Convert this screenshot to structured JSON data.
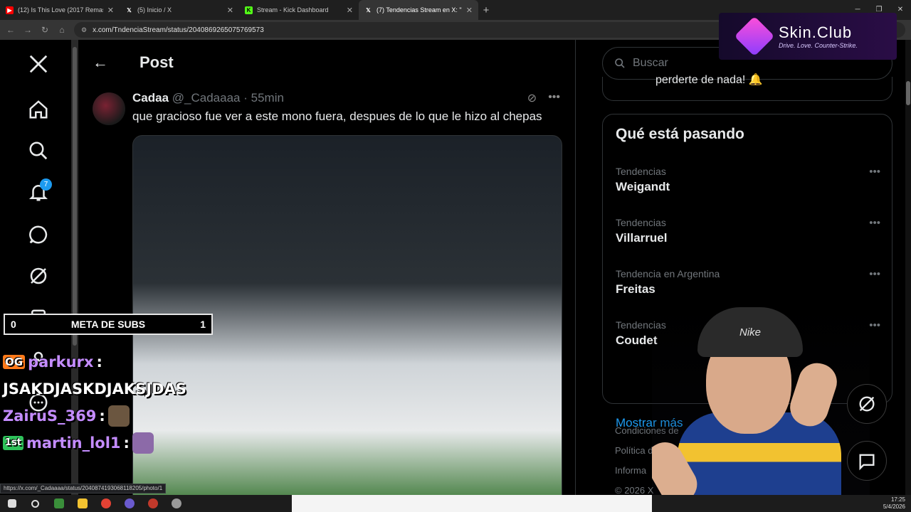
{
  "browser": {
    "tabs": [
      {
        "title": "(12) Is This Love (2017 Remaste",
        "favicon": "youtube-icon",
        "color": "#ff0000"
      },
      {
        "title": "(5) Inicio / X",
        "favicon": "x-icon",
        "color": "#ffffff"
      },
      {
        "title": "Stream - Kick Dashboard",
        "favicon": "kick-icon",
        "color": "#53fc18"
      },
      {
        "title": "(7) Tendencias Stream en X: \"\"M",
        "favicon": "x-icon",
        "color": "#ffffff"
      }
    ],
    "url": "x.com/TndenciaStream/status/2040869265075769573",
    "status_url": "https://x.com/_Cadaaaa/status/2040874193068118205/photo/1"
  },
  "nav": {
    "notification_count": "7",
    "icons": [
      "x-logo-icon",
      "home-icon",
      "search-icon",
      "bell-icon",
      "messages-icon",
      "grok-icon",
      "lists-icon",
      "profile-icon",
      "more-icon"
    ]
  },
  "main": {
    "header_title": "Post",
    "reply": {
      "display_name": "Cadaa",
      "handle": "@_Cadaaaa",
      "separator": "·",
      "time": "55min",
      "text": "que gracioso fue ver a este mono fuera, despues de lo que le hizo al chepas"
    }
  },
  "right": {
    "search_placeholder": "Buscar",
    "prev_card_text": "perderte de nada! 🔔",
    "trends_title": "Qué está pasando",
    "trends": [
      {
        "category": "Tendencias",
        "name": "Weigandt"
      },
      {
        "category": "Tendencias",
        "name": "Villarruel"
      },
      {
        "category": "Tendencia en Argentina",
        "name": "Freitas"
      },
      {
        "category": "Tendencias",
        "name": "Coudet"
      }
    ],
    "show_more": "Mostrar más",
    "footer": [
      "Condiciones de",
      "Política de coo",
      "Informa",
      "© 2026 X"
    ]
  },
  "overlay": {
    "brand": "Skin.Club",
    "tagline": "Drive. Love. Counter-Strike.",
    "meta_left": "0",
    "meta_label": "META DE SUBS",
    "meta_right": "1",
    "chat": [
      {
        "badge": "OG",
        "user": "parkurx",
        "colon": ":"
      },
      {
        "message": "JSAKDJASKDJAKSJDAS"
      },
      {
        "user": "ZairuS_369",
        "colon": ":"
      },
      {
        "badge": "1st",
        "user": "martin_lol1",
        "colon": ":"
      }
    ],
    "webcam_cap_text": "Nike"
  },
  "taskbar": {
    "time": "17:25",
    "date": "5/4/2026"
  }
}
